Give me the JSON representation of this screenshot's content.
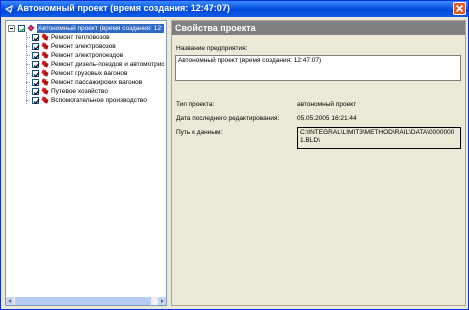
{
  "window": {
    "title": "Автономный проект (время создания: 12:47:07)"
  },
  "tree": {
    "root_label": "Автономный проект (время создания: 12:",
    "items": [
      {
        "label": "Ремонт тепловозов"
      },
      {
        "label": "Ремонт электровозов"
      },
      {
        "label": "Ремонт электропоездов"
      },
      {
        "label": "Ремонт дизель-поездов и автомотрис"
      },
      {
        "label": "Ремонт грузовых вагонов"
      },
      {
        "label": "Ремонт пассажирских вагонов"
      },
      {
        "label": "Путевое хозяйство"
      },
      {
        "label": "Вспомогательное производство"
      }
    ]
  },
  "properties": {
    "header": "Свойства проекта",
    "company_name_label": "Название предприятия:",
    "company_name_value": "Автономный проект (время создания: 12:47:07)",
    "project_type_label": "Тип проекта:",
    "project_type_value": "автономный проект",
    "last_edit_label": "Дата последнего редактирования:",
    "last_edit_value": "05.05.2005 16:21:44",
    "data_path_label": "Путь к данным:",
    "data_path_value": "C:\\INTEGRAL\\LIMIT3\\METHOD\\RAIL\\DATA\\00000001.BLD\\"
  },
  "colors": {
    "titlebar": "#0a56e6",
    "selection": "#316ac5",
    "header_gray": "#808080",
    "close_red": "#e5582d"
  }
}
